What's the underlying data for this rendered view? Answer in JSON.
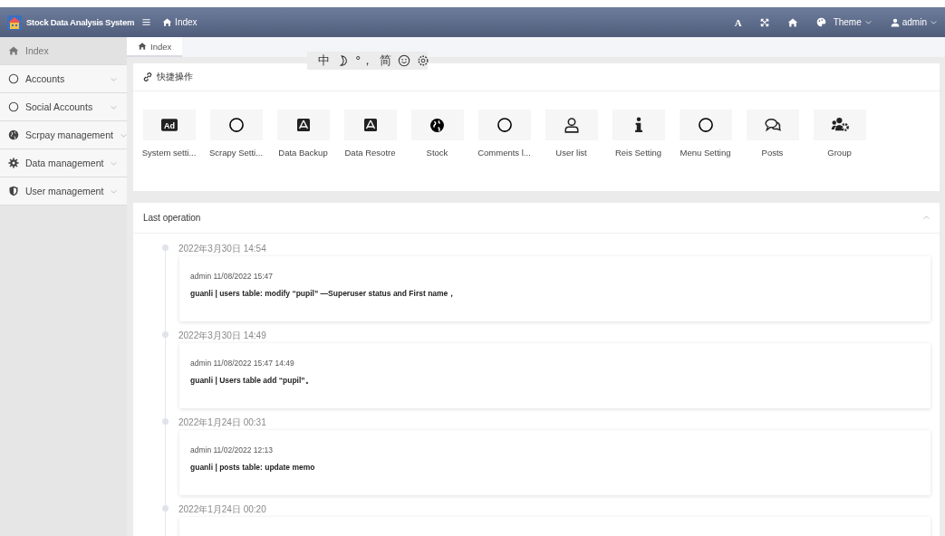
{
  "header": {
    "title": "Stock Data Analysis System",
    "breadcrumb": "Index",
    "font_button": "A",
    "theme": "Theme",
    "user": "admin"
  },
  "ime_toolbar": {
    "language": "中",
    "punctuation": "°，",
    "script": "简"
  },
  "sidebar": {
    "items": [
      {
        "label": "Index",
        "selected": true,
        "submenu": false
      },
      {
        "label": "Accounts",
        "selected": false,
        "submenu": true
      },
      {
        "label": "Social Accounts",
        "selected": false,
        "submenu": true
      },
      {
        "label": "Scrpay management",
        "selected": false,
        "submenu": true
      },
      {
        "label": "Data management",
        "selected": false,
        "submenu": true
      },
      {
        "label": "User management",
        "selected": false,
        "submenu": true
      }
    ]
  },
  "tabs": [
    {
      "label": "Index",
      "selected": true
    }
  ],
  "quick_actions": {
    "title": "快捷操作",
    "items": [
      {
        "label": "System setti...",
        "kind": "ad",
        "icon_text": "Ad"
      },
      {
        "label": "Scrapy Setti...",
        "kind": "circle"
      },
      {
        "label": "Data Backup",
        "kind": "appstore"
      },
      {
        "label": "Data Resotre",
        "kind": "appstore"
      },
      {
        "label": "Stock",
        "kind": "globe"
      },
      {
        "label": "Comments l...",
        "kind": "circle"
      },
      {
        "label": "User list",
        "kind": "user"
      },
      {
        "label": "Reis Setting",
        "kind": "info"
      },
      {
        "label": "Menu Setting",
        "kind": "circle"
      },
      {
        "label": "Posts",
        "kind": "chat"
      },
      {
        "label": "Group",
        "kind": "group"
      }
    ]
  },
  "last_operation": {
    "title": "Last operation",
    "expanded": true,
    "entries": [
      {
        "date": "2022年3月30日 14:54",
        "meta": "admin 11/08/2022 15:47",
        "message": "guanli | users table: modify “pupil” —Superuser status and First name，"
      },
      {
        "date": "2022年3月30日 14:49",
        "meta": "admin 11/08/2022 15:47 14:49",
        "message": "guanli | Users table add “pupil”。"
      },
      {
        "date": "2022年1月24日 00:31",
        "meta": "admin 11/02/2022 12:13",
        "message": "guanli | posts table: update memo"
      },
      {
        "date": "2022年1月24日 00:20"
      }
    ]
  }
}
